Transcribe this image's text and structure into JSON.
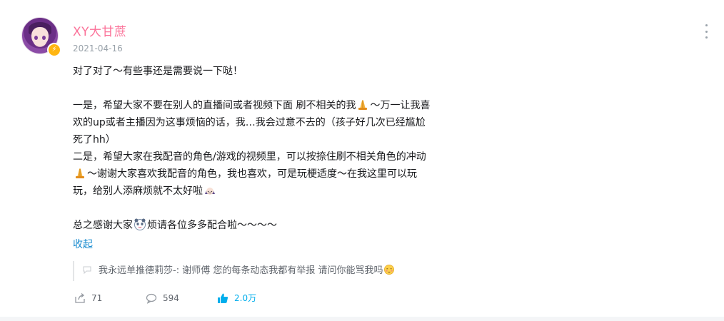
{
  "post": {
    "username": "XY大甘蔗",
    "date": "2021-04-16",
    "lines": [
      "对了对了～有些事还是需要说一下哒！",
      "",
      "一是，希望大家不要在别人的直播间或者视频下面 刷不相关的我",
      "～万一让我喜",
      "欢的up或者主播因为这事烦恼的话，我…我会过意不去的（孩子好几次已经尴尬",
      "死了hh）",
      "二是，希望大家在我配音的角色/游戏的视频里，可以按捺住刷不相关角色的冲动",
      "～谢谢大家喜欢我配音的角色，我也喜欢，可是玩梗适度～在我这里可以玩",
      "玩，给别人添麻烦就不太好啦",
      "",
      "总之感谢大家",
      "烦请各位多多配合啦～～～～"
    ],
    "collapse_label": "收起"
  },
  "comment": {
    "author": "我永远单推德莉莎-:",
    "text": "谢师傅 您的每条动态我都有举报 请问你能骂我吗"
  },
  "actions": {
    "share_count": "71",
    "comment_count": "594",
    "like_count": "2.0万"
  },
  "colors": {
    "username": "#fb7299",
    "link": "#178bcf",
    "like": "#00aeec",
    "badge": "#ffb612"
  },
  "icons": [
    "pray-emoji",
    "cry-emoji",
    "panda-emoji",
    "blush-emoji",
    "share-icon",
    "comment-icon",
    "like-icon",
    "more-icon"
  ]
}
